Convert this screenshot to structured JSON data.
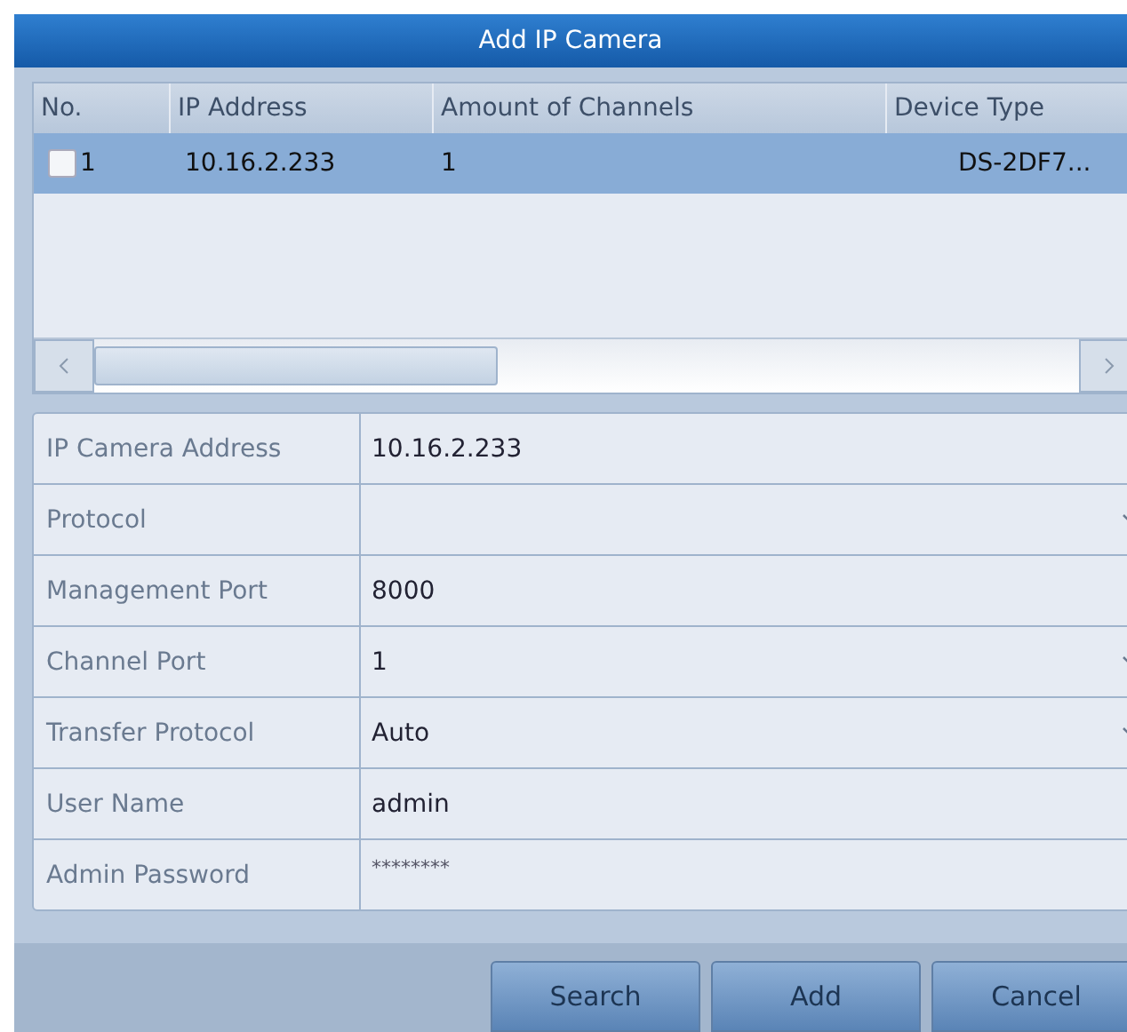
{
  "window": {
    "title": "Add IP Camera"
  },
  "table": {
    "columns": [
      "No.",
      "IP Address",
      "Amount of Channels",
      "Device Type"
    ],
    "rows": [
      {
        "selected": true,
        "checked": false,
        "cells": [
          "1",
          "10.16.2.233",
          "1",
          "DS-2DF7..."
        ]
      }
    ]
  },
  "form": [
    {
      "label": "IP Camera Address",
      "value": "10.16.2.233",
      "kind": "text"
    },
    {
      "label": "Protocol",
      "kind": "select"
    },
    {
      "label": "Management Port",
      "value": "8000",
      "kind": "text"
    },
    {
      "label": "Channel Port",
      "value": "1",
      "kind": "select"
    },
    {
      "label": "Transfer Protocol",
      "value": "Auto",
      "kind": "select"
    },
    {
      "label": "User Name",
      "value": "admin",
      "kind": "text"
    },
    {
      "label": "Admin Password",
      "value": "********",
      "kind": "password"
    }
  ],
  "buttons": [
    "Search",
    "Add",
    "Cancel"
  ]
}
